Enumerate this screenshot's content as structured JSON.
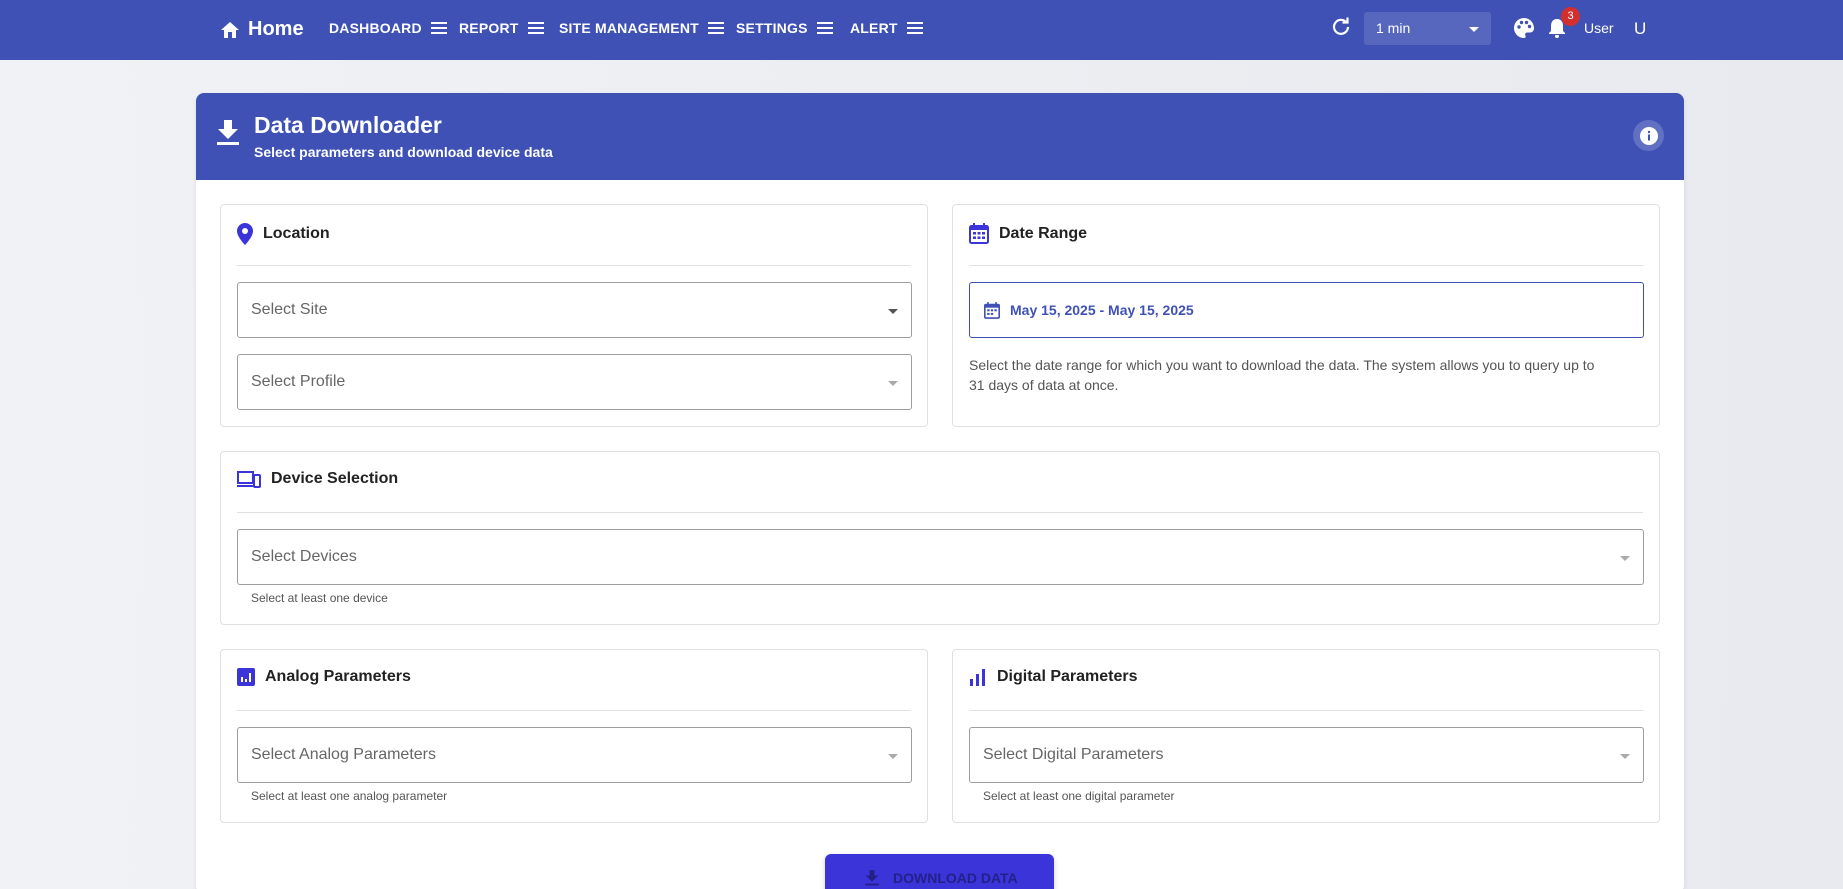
{
  "topbar": {
    "home_label": "Home",
    "nav": [
      {
        "label": "DASHBOARD"
      },
      {
        "label": "REPORT"
      },
      {
        "label": "SITE MANAGEMENT"
      },
      {
        "label": "SETTINGS"
      },
      {
        "label": "ALERT"
      }
    ],
    "interval": "1 min",
    "notification_count": "3",
    "user_label": "User",
    "avatar_initial": "U",
    "color": "#3f51b5"
  },
  "card": {
    "title": "Data Downloader",
    "subtitle": "Select parameters and download device data"
  },
  "location": {
    "title": "Location",
    "site_placeholder": "Select Site",
    "profile_placeholder": "Select Profile"
  },
  "date_range": {
    "title": "Date Range",
    "value": "May 15, 2025 - May 15, 2025",
    "description": "Select the date range for which you want to download the data. The system allows you to query up to 31 days of data at once."
  },
  "devices": {
    "title": "Device Selection",
    "placeholder": "Select Devices",
    "hint": "Select at least one device"
  },
  "analog": {
    "title": "Analog Parameters",
    "placeholder": "Select Analog Parameters",
    "hint": "Select at least one analog parameter"
  },
  "digital": {
    "title": "Digital Parameters",
    "placeholder": "Select Digital Parameters",
    "hint": "Select at least one digital parameter"
  },
  "download_label": "DOWNLOAD DATA",
  "accent_color": "#3a34d9"
}
